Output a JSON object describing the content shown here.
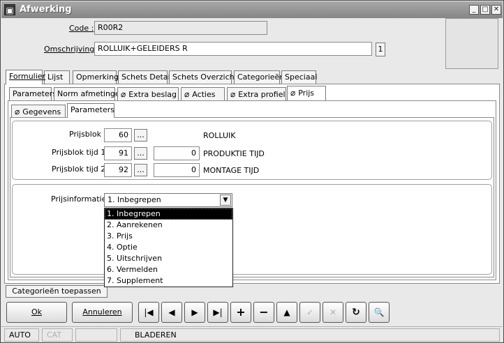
{
  "window": {
    "title": "Afwerking",
    "controls": {
      "minimize": "_",
      "maximize": "□",
      "close": "✕"
    }
  },
  "header": {
    "code_label": "Code :",
    "code_value": "R00R2",
    "omschrijving_label": "Omschrijving :",
    "omschrijving_value": "ROLLUIK+GELEIDERS  R",
    "omschrijving_index": "1"
  },
  "main_tabs": [
    {
      "label": "Formulier"
    },
    {
      "label": "Lijst"
    },
    {
      "label": "Opmerking"
    },
    {
      "label": "Schets Detail"
    },
    {
      "label": "Schets Overzicht"
    },
    {
      "label": "Categorieën"
    },
    {
      "label": "Speciaal"
    }
  ],
  "sub_tabs": [
    {
      "label": "Parameters"
    },
    {
      "label": "Norm afmetingen"
    },
    {
      "label": "Extra beslag"
    },
    {
      "label": "Acties"
    },
    {
      "label": "Extra profiel"
    },
    {
      "label": "Prijs"
    }
  ],
  "inner_tabs": [
    {
      "label": "Gegevens"
    },
    {
      "label": "Parameters"
    }
  ],
  "prijs": {
    "rows": [
      {
        "label": "Prijsblok :",
        "value": "60",
        "button": "...",
        "extra": "",
        "desc": "ROLLUIK"
      },
      {
        "label": "Prijsblok tijd 1 :",
        "value": "91",
        "button": "...",
        "extra": "0",
        "desc": "PRODUKTIE TIJD"
      },
      {
        "label": "Prijsblok tijd 2 :",
        "value": "92",
        "button": "...",
        "extra": "0",
        "desc": "MONTAGE TIJD"
      }
    ],
    "info_label": "Prijsinformatie :",
    "info_selected": "1.  Inbegrepen",
    "info_options": [
      "1.  Inbegrepen",
      "2.  Aanrekenen",
      "3.  Prijs",
      "4.  Optie",
      "5.  Uitschrijven",
      "6.  Vermelden",
      "7.  Supplement"
    ]
  },
  "categorieen_button": "Categorieën toepassen",
  "buttons": {
    "ok": "Ok",
    "annuleren": "Annuleren"
  },
  "nav_glyphs": {
    "first": "|◀",
    "prev": "◀",
    "next": "▶",
    "last": "▶|",
    "add": "+",
    "remove": "−",
    "up": "▲",
    "confirm": "✓",
    "cancel": "✕",
    "refresh": "↻",
    "find": "🔍"
  },
  "status": {
    "mode": "AUTO",
    "cat": "CAT",
    "blank": "",
    "state": "BLADEREN"
  },
  "icons": {
    "attachment": "paperclip-icon",
    "find": "binoculars-icon"
  }
}
